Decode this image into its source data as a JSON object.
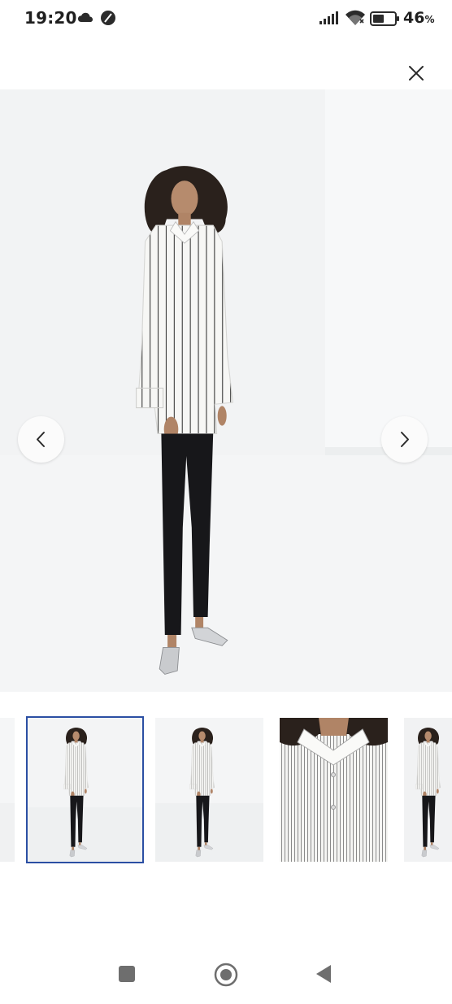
{
  "status_bar": {
    "time": "19:20",
    "battery_percent": "46",
    "battery_unit": "%",
    "icons": [
      "cloud-icon",
      "do-not-disturb-icon",
      "signal-icon",
      "wifi-icon",
      "battery-icon"
    ]
  },
  "viewer": {
    "close_icon": "close-icon",
    "prev_icon": "chevron-left-icon",
    "next_icon": "chevron-right-icon",
    "selected_index": 1,
    "thumbnails": [
      {
        "view": "side"
      },
      {
        "view": "front-full"
      },
      {
        "view": "side-full"
      },
      {
        "view": "collar-closeup"
      },
      {
        "view": "side-crop"
      }
    ]
  },
  "system_nav": {
    "icons": [
      "recents-square-icon",
      "home-circle-icon",
      "back-triangle-icon"
    ]
  },
  "colors": {
    "selected_border": "#2b4fa3",
    "background": "#ffffff"
  }
}
